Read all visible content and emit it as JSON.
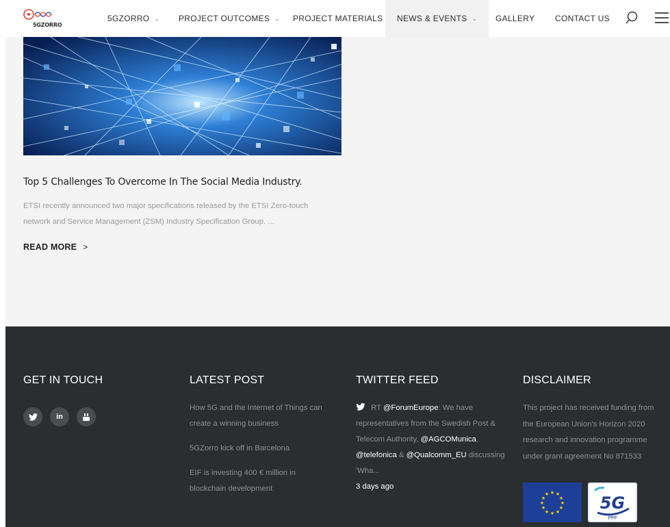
{
  "header": {
    "logo_text": "5GZORRO",
    "nav": [
      {
        "label": "5GZORRO",
        "has_dropdown": true
      },
      {
        "label": "PROJECT OUTCOMES",
        "has_dropdown": true
      },
      {
        "label": "PROJECT MATERIALS",
        "has_dropdown": false
      },
      {
        "label": "NEWS & EVENTS",
        "has_dropdown": true,
        "active": true
      },
      {
        "label": "GALLERY",
        "has_dropdown": false
      },
      {
        "label": "CONTACT US",
        "has_dropdown": false
      }
    ],
    "search_icon": "search-icon",
    "menu_icon": "hamburger-menu-icon"
  },
  "post": {
    "title": "Top 5 Challenges To Overcome In The Social Media Industry.",
    "excerpt": "ETSI recently announced two major specifications released by the ETSI Zero-touch network and Service Management (ZSM) Industry Specification Group. ...",
    "read_more": "READ MORE"
  },
  "footer": {
    "get_in_touch": {
      "title": "GET IN TOUCH",
      "socials": [
        {
          "icon": "twitter-icon",
          "glyph": "t"
        },
        {
          "icon": "linkedin-icon",
          "glyph": "in"
        },
        {
          "icon": "youtube-icon",
          "glyph": "▶"
        }
      ]
    },
    "latest_post": {
      "title": "LATEST POST",
      "items": [
        "How 5G and the Internet of Things can create a winning business",
        "5GZorro kick off in Barcelona",
        "EIF is investing 400 € million in blockchain development"
      ]
    },
    "twitter_feed": {
      "title": "TWITTER FEED",
      "tweet_prefix": "RT ",
      "mention1": "@ForumEurope",
      "text1": ": We have representatives from the Swedish Post & Telecom Authority, ",
      "mention2": "@AGCOMunica",
      "text2": ", ",
      "mention3": "@telefonica",
      "text3": " & ",
      "mention4": "@Qualcomm_EU",
      "text4": " discussing 'Wha...",
      "time": "3 days ago"
    },
    "disclaimer": {
      "title": "DISCLAIMER",
      "text": "This project has received funding from the European Union's Horizon 2020 research and innovation programme under grant agreement No 871533",
      "ppp_label": "PPP"
    }
  },
  "colors": {
    "footer_bg": "#2b2e31",
    "page_bg": "#f4f4f4",
    "muted_text": "#8d9094",
    "accent_blue": "#1d3f97"
  }
}
